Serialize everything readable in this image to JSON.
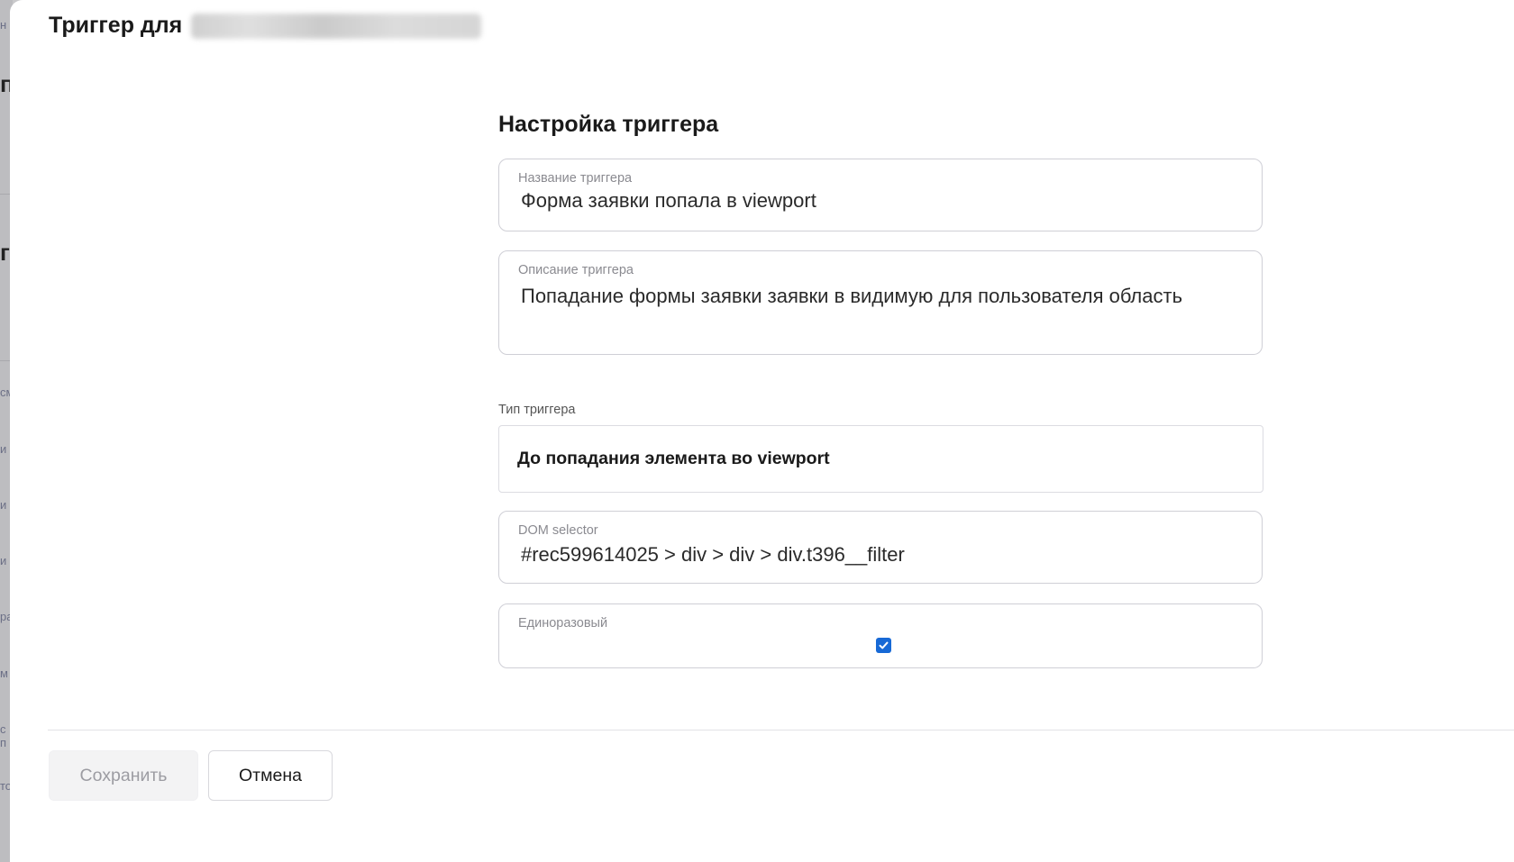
{
  "drawer": {
    "title": "Триггер для"
  },
  "form": {
    "section_title": "Настройка триггера",
    "name_field": {
      "label": "Название триггера",
      "value": "Форма заявки попала в viewport"
    },
    "description_field": {
      "label": "Описание триггера",
      "value": "Попадание формы заявки заявки в видимую для пользователя область"
    },
    "trigger_type": {
      "label": "Тип триггера",
      "selected": "До попадания элемента во viewport"
    },
    "dom_selector_field": {
      "label": "DOM selector",
      "value": "#rec599614025 > div > div > div.t396__filter"
    },
    "one_time_field": {
      "label": "Единоразовый",
      "checked": true
    }
  },
  "actions": {
    "save_label": "Сохранить",
    "cancel_label": "Отмена"
  },
  "background_fragments": [
    "н",
    "п",
    "г",
    "см",
    "и",
    "и",
    "и",
    "ра",
    "м",
    "с п",
    "то"
  ],
  "colors": {
    "accent": "#1769d6",
    "border": "#cfcfd6",
    "text": "#1a1a1a",
    "muted": "#8a8a90",
    "disabled_text": "#9c9ca2"
  }
}
